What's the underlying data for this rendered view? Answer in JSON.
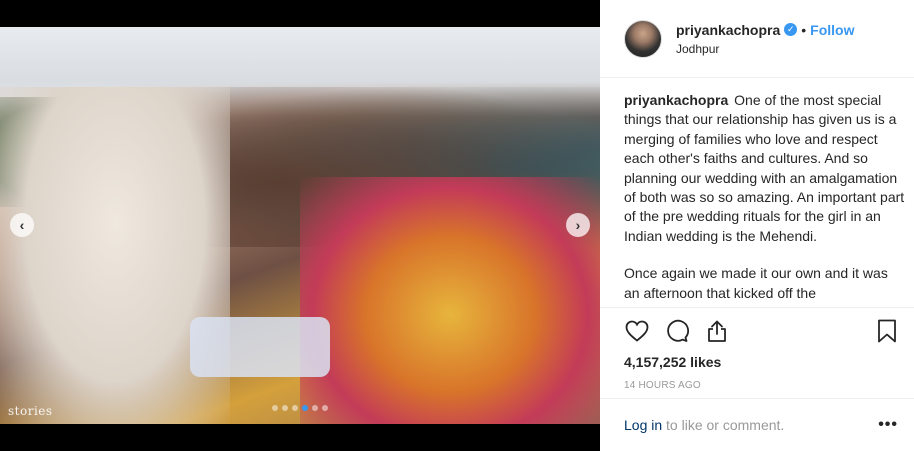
{
  "post": {
    "username": "priyankachopra",
    "verified_icon": "verified-badge-icon",
    "separator": "•",
    "follow_label": "Follow",
    "location": "Jodhpur",
    "caption_p1": "One of the most special things that our relationship has given us is a merging of families who love and respect each other's faiths and cultures. And so planning our wedding with an amalgamation of both was so so amazing. An important part of the pre wedding rituals for the girl in an Indian wedding is the Mehendi.",
    "caption_p2": "Once again we made it our own and it was an afternoon that kicked off the",
    "likes": "4,157,252 likes",
    "timestamp": "14 HOURS AGO",
    "login_link": "Log in",
    "login_rest": " to like or comment.",
    "more_label": "•••"
  },
  "media": {
    "watermark": "stories",
    "prev_label": "‹",
    "next_label": "›",
    "carousel_count": 6,
    "carousel_active": 4
  },
  "colors": {
    "accent": "#3897f0",
    "text": "#262626",
    "muted": "#999999"
  }
}
